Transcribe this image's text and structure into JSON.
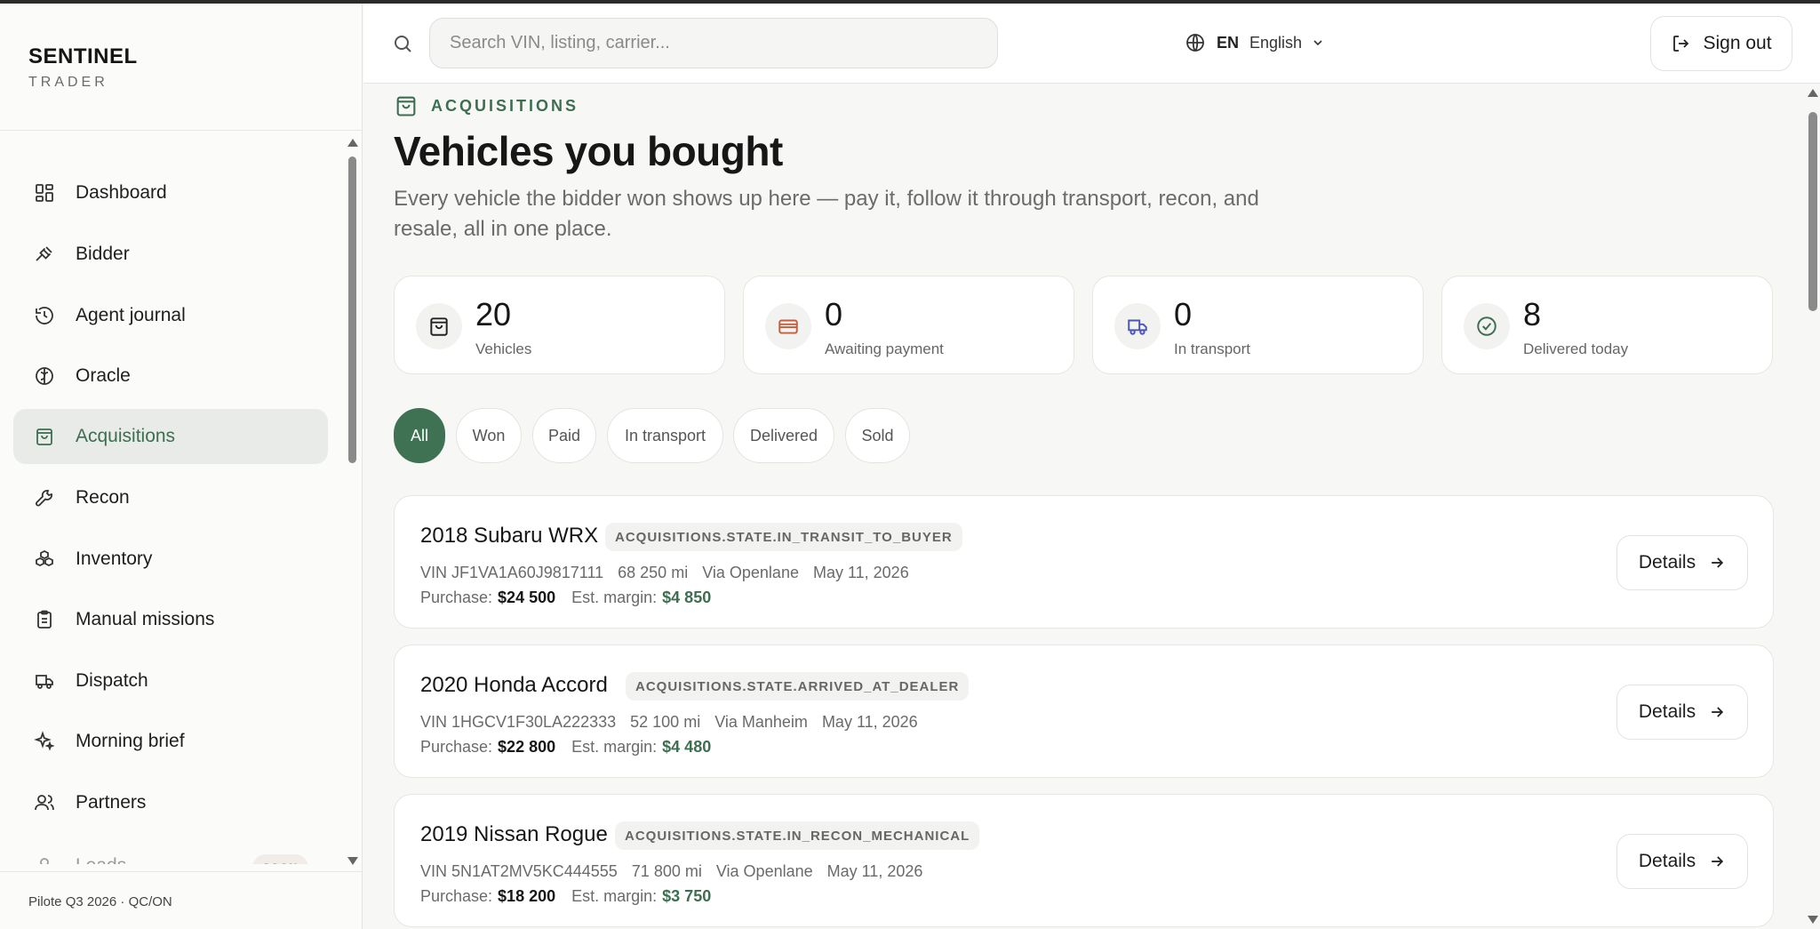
{
  "brand": {
    "name": "SENTINEL",
    "sub": "TRADER"
  },
  "sidebar": {
    "items": [
      {
        "label": "Dashboard",
        "icon": "dashboard-icon"
      },
      {
        "label": "Bidder",
        "icon": "gavel-icon"
      },
      {
        "label": "Agent journal",
        "icon": "history-icon"
      },
      {
        "label": "Oracle",
        "icon": "brain-icon"
      },
      {
        "label": "Acquisitions",
        "icon": "shopping-bag-icon",
        "active": true
      },
      {
        "label": "Recon",
        "icon": "wrench-icon"
      },
      {
        "label": "Inventory",
        "icon": "boxes-icon"
      },
      {
        "label": "Manual missions",
        "icon": "clipboard-icon"
      },
      {
        "label": "Dispatch",
        "icon": "truck-icon"
      },
      {
        "label": "Morning brief",
        "icon": "sparkles-icon"
      },
      {
        "label": "Partners",
        "icon": "users-icon"
      },
      {
        "label": "Leads",
        "icon": "user-icon",
        "badge": "SOON"
      }
    ],
    "footer": "Pilote Q3 2026 · QC/ON"
  },
  "header": {
    "search_placeholder": "Search VIN, listing, carrier...",
    "lang_code": "EN",
    "lang_name": "English",
    "signout_label": "Sign out"
  },
  "main": {
    "kicker": "ACQUISITIONS",
    "title": "Vehicles you bought",
    "description": "Every vehicle the bidder won shows up here — pay it, follow it through transport, recon, and resale, all in one place.",
    "stats": [
      {
        "value": "20",
        "label": "Vehicles",
        "icon": "shopping-bag-icon"
      },
      {
        "value": "0",
        "label": "Awaiting payment",
        "icon": "credit-card-icon"
      },
      {
        "value": "0",
        "label": "In transport",
        "icon": "truck-icon"
      },
      {
        "value": "8",
        "label": "Delivered today",
        "icon": "check-circle-icon"
      }
    ],
    "filters": [
      {
        "label": "All",
        "active": true
      },
      {
        "label": "Won"
      },
      {
        "label": "Paid"
      },
      {
        "label": "In transport"
      },
      {
        "label": "Delivered"
      },
      {
        "label": "Sold"
      }
    ],
    "vehicles": [
      {
        "title": "2018 Subaru WRX",
        "state": "ACQUISITIONS.STATE.IN_TRANSIT_TO_BUYER",
        "vin": "VIN JF1VA1A60J9817111",
        "mileage": "68 250 mi",
        "via": "Via Openlane",
        "date": "May 11, 2026",
        "purchase_label": "Purchase:",
        "purchase": "$24 500",
        "margin_label": "Est. margin:",
        "margin": "$4 850",
        "details_label": "Details"
      },
      {
        "title": "2020 Honda Accord",
        "state": "ACQUISITIONS.STATE.ARRIVED_AT_DEALER",
        "vin": "VIN 1HGCV1F30LA222333",
        "mileage": "52 100 mi",
        "via": "Via Manheim",
        "date": "May 11, 2026",
        "purchase_label": "Purchase:",
        "purchase": "$22 800",
        "margin_label": "Est. margin:",
        "margin": "$4 480",
        "details_label": "Details"
      },
      {
        "title": "2019 Nissan Rogue",
        "state": "ACQUISITIONS.STATE.IN_RECON_MECHANICAL",
        "vin": "VIN 5N1AT2MV5KC444555",
        "mileage": "71 800 mi",
        "via": "Via Openlane",
        "date": "May 11, 2026",
        "purchase_label": "Purchase:",
        "purchase": "$18 200",
        "margin_label": "Est. margin:",
        "margin": "$3 750",
        "details_label": "Details"
      }
    ]
  },
  "colors": {
    "accent": "#3e7253",
    "soon": "#b0593a",
    "card_icon": "#c0603e",
    "truck_icon": "#4a55b8"
  }
}
